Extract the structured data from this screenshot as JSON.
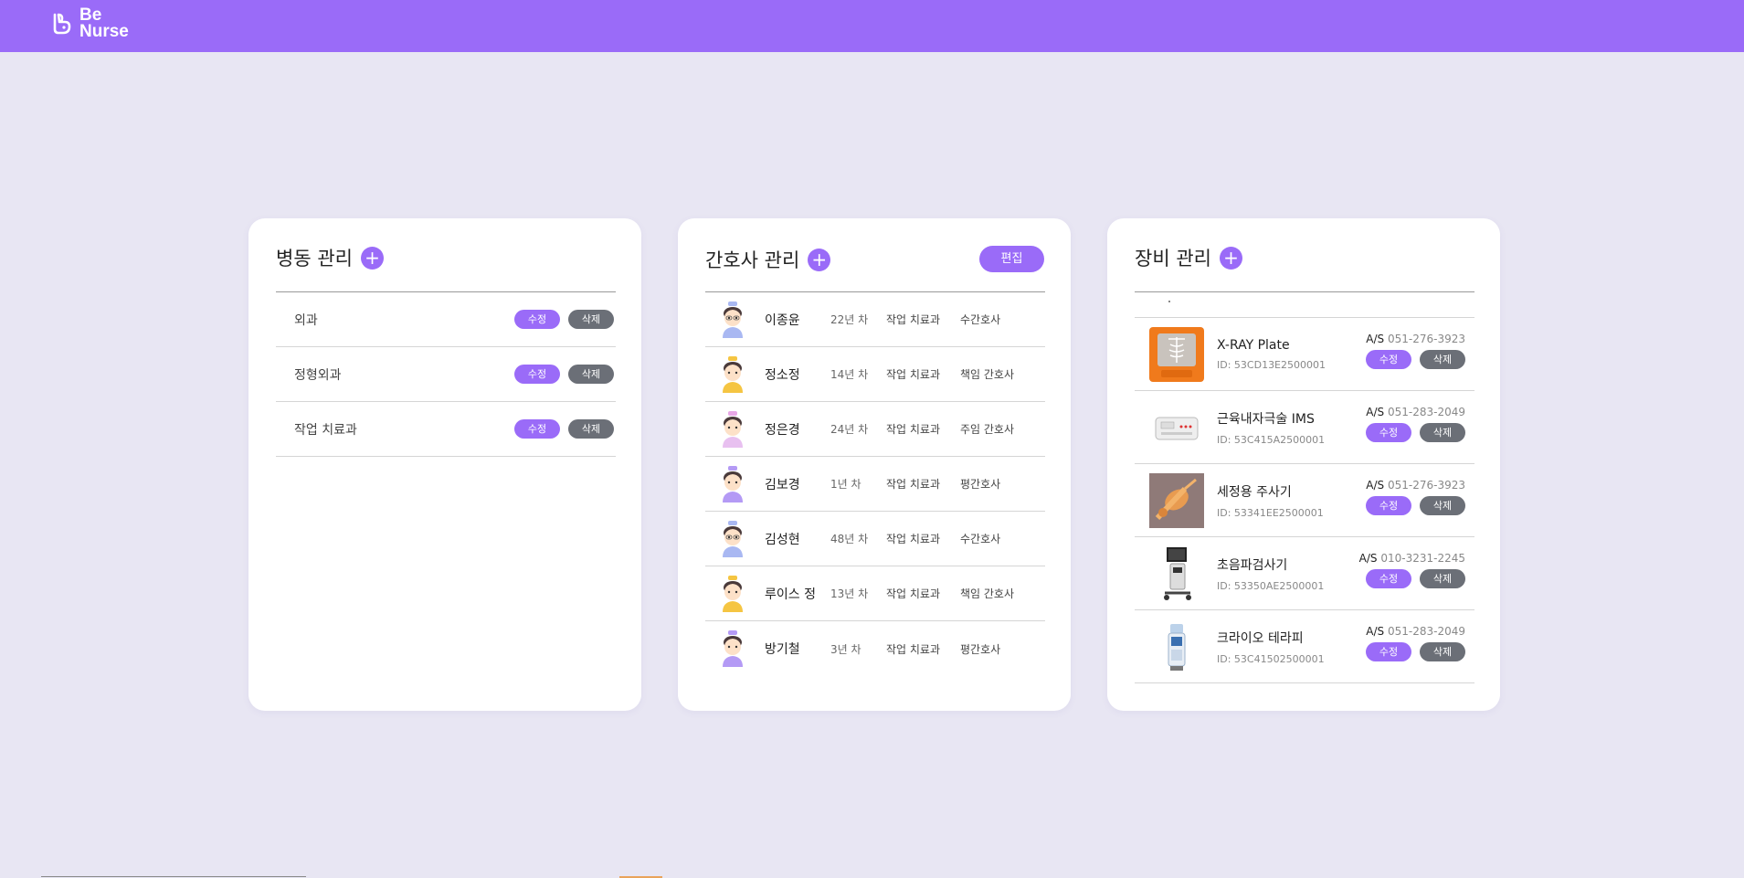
{
  "app": {
    "brand_line1": "Be",
    "brand_line2": "Nurse",
    "accent_color": "#9a6bf8",
    "delete_color": "#6b6f77"
  },
  "ward_panel": {
    "title": "병동 관리",
    "add_icon": "+",
    "rows": [
      {
        "name": "외과",
        "edit": "수정",
        "delete": "삭제"
      },
      {
        "name": "정형외과",
        "edit": "수정",
        "delete": "삭제"
      },
      {
        "name": "작업 치료과",
        "edit": "수정",
        "delete": "삭제"
      }
    ]
  },
  "nurse_panel": {
    "title": "간호사 관리",
    "add_icon": "+",
    "edit_label": "편집",
    "rows": [
      {
        "name": "이종윤",
        "years": "22년 차",
        "dept": "작업 치료과",
        "role": "수간호사",
        "avatar": "nurse-avatar-blue"
      },
      {
        "name": "정소정",
        "years": "14년 차",
        "dept": "작업 치료과",
        "role": "책임 간호사",
        "avatar": "nurse-avatar-yellow"
      },
      {
        "name": "정은경",
        "years": "24년 차",
        "dept": "작업 치료과",
        "role": "주임 간호사",
        "avatar": "nurse-avatar-pink"
      },
      {
        "name": "김보경",
        "years": "1년 차",
        "dept": "작업 치료과",
        "role": "평간호사",
        "avatar": "nurse-avatar-purple"
      },
      {
        "name": "김성현",
        "years": "48년 차",
        "dept": "작업 치료과",
        "role": "수간호사",
        "avatar": "nurse-avatar-blue"
      },
      {
        "name": "루이스 정",
        "years": "13년 차",
        "dept": "작업 치료과",
        "role": "책임 간호사",
        "avatar": "nurse-avatar-yellow"
      },
      {
        "name": "방기철",
        "years": "3년 차",
        "dept": "작업 치료과",
        "role": "평간호사",
        "avatar": "nurse-avatar-purple"
      }
    ]
  },
  "equipment_panel": {
    "title": "장비 관리",
    "add_icon": "+",
    "rows": [
      {
        "name": "X-RAY Plate",
        "id": "ID: 53CD13E2500001",
        "as_label": "A/S",
        "phone": "051-276-3923",
        "edit": "수정",
        "delete": "삭제",
        "image": "xray-plate-image"
      },
      {
        "name": "근육내자극술 IMS",
        "id": "ID: 53C415A2500001",
        "as_label": "A/S",
        "phone": "051-283-2049",
        "edit": "수정",
        "delete": "삭제",
        "image": "ims-device-image"
      },
      {
        "name": "세정용 주사기",
        "id": "ID: 53341EE2500001",
        "as_label": "A/S",
        "phone": "051-276-3923",
        "edit": "수정",
        "delete": "삭제",
        "image": "syringe-image"
      },
      {
        "name": "초음파검사기",
        "id": "ID: 53350AE2500001",
        "as_label": "A/S",
        "phone": "010-3231-2245",
        "edit": "수정",
        "delete": "삭제",
        "image": "ultrasound-image"
      },
      {
        "name": "크라이오 테라피",
        "id": "ID: 53C41502500001",
        "as_label": "A/S",
        "phone": "051-283-2049",
        "edit": "수정",
        "delete": "삭제",
        "image": "cryo-therapy-image"
      }
    ]
  }
}
